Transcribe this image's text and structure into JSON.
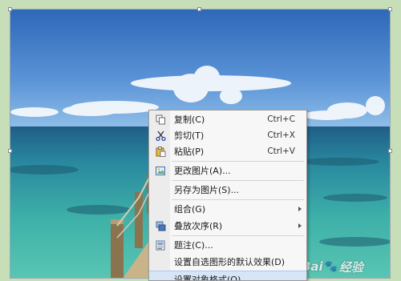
{
  "menu": {
    "items": [
      {
        "label": "复制(C)",
        "shortcut": "Ctrl+C",
        "icon": "copy-icon"
      },
      {
        "label": "剪切(T)",
        "shortcut": "Ctrl+X",
        "icon": "scissors-icon"
      },
      {
        "label": "粘贴(P)",
        "shortcut": "Ctrl+V",
        "icon": "paste-icon"
      },
      {
        "label": "更改图片(A)...",
        "icon": "change-picture-icon"
      },
      {
        "label": "另存为图片(S)..."
      },
      {
        "label": "组合(G)",
        "submenu": true
      },
      {
        "label": "叠放次序(R)",
        "submenu": true,
        "icon": "stack-order-icon"
      },
      {
        "label": "题注(C)...",
        "icon": "caption-icon"
      },
      {
        "label": "设置自选图形的默认效果(D)"
      },
      {
        "label": "设置对象格式(O)..."
      }
    ]
  },
  "watermark": {
    "brand_left": "Bai",
    "brand_right": "经验",
    "paw": "🐾"
  },
  "colors": {
    "accent_highlight": "#d6e6f7",
    "frame_background": "#c6dfb9"
  }
}
